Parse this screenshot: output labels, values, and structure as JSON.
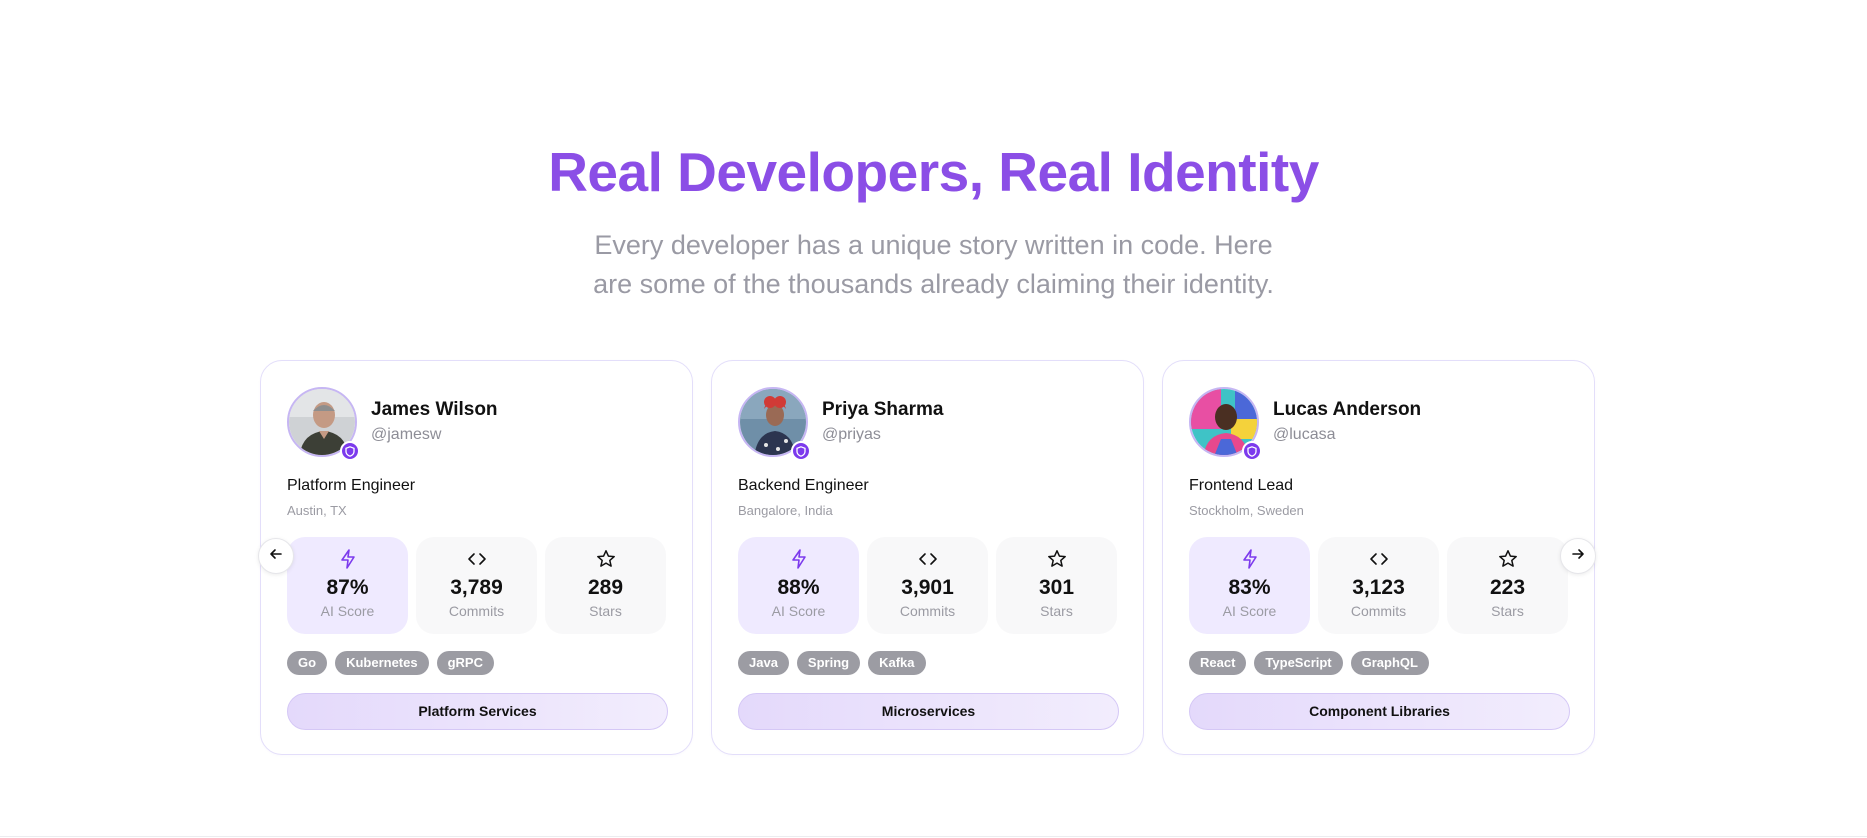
{
  "header": {
    "title": "Real Developers, Real Identity",
    "subtitle_line1": "Every developer has a unique story written in code. Here",
    "subtitle_line2": "are some of the thousands already claiming their identity."
  },
  "colors": {
    "accent": "#8b4ee6",
    "verified_badge": "#7c3aed",
    "tag_bg": "#9c9ca3"
  },
  "carousel": {
    "prev_icon": "arrow-left-icon",
    "next_icon": "arrow-right-icon"
  },
  "cards": [
    {
      "name": "James Wilson",
      "handle": "@jamesw",
      "role": "Platform Engineer",
      "location": "Austin, TX",
      "stats": [
        {
          "icon": "lightning-icon",
          "value": "87%",
          "label": "AI Score"
        },
        {
          "icon": "code-icon",
          "value": "3,789",
          "label": "Commits"
        },
        {
          "icon": "star-icon",
          "value": "289",
          "label": "Stars"
        }
      ],
      "tags": [
        "Go",
        "Kubernetes",
        "gRPC"
      ],
      "project": "Platform Services"
    },
    {
      "name": "Priya Sharma",
      "handle": "@priyas",
      "role": "Backend Engineer",
      "location": "Bangalore, India",
      "stats": [
        {
          "icon": "lightning-icon",
          "value": "88%",
          "label": "AI Score"
        },
        {
          "icon": "code-icon",
          "value": "3,901",
          "label": "Commits"
        },
        {
          "icon": "star-icon",
          "value": "301",
          "label": "Stars"
        }
      ],
      "tags": [
        "Java",
        "Spring",
        "Kafka"
      ],
      "project": "Microservices"
    },
    {
      "name": "Lucas Anderson",
      "handle": "@lucasa",
      "role": "Frontend Lead",
      "location": "Stockholm, Sweden",
      "stats": [
        {
          "icon": "lightning-icon",
          "value": "83%",
          "label": "AI Score"
        },
        {
          "icon": "code-icon",
          "value": "3,123",
          "label": "Commits"
        },
        {
          "icon": "star-icon",
          "value": "223",
          "label": "Stars"
        }
      ],
      "tags": [
        "React",
        "TypeScript",
        "GraphQL"
      ],
      "project": "Component Libraries"
    }
  ]
}
